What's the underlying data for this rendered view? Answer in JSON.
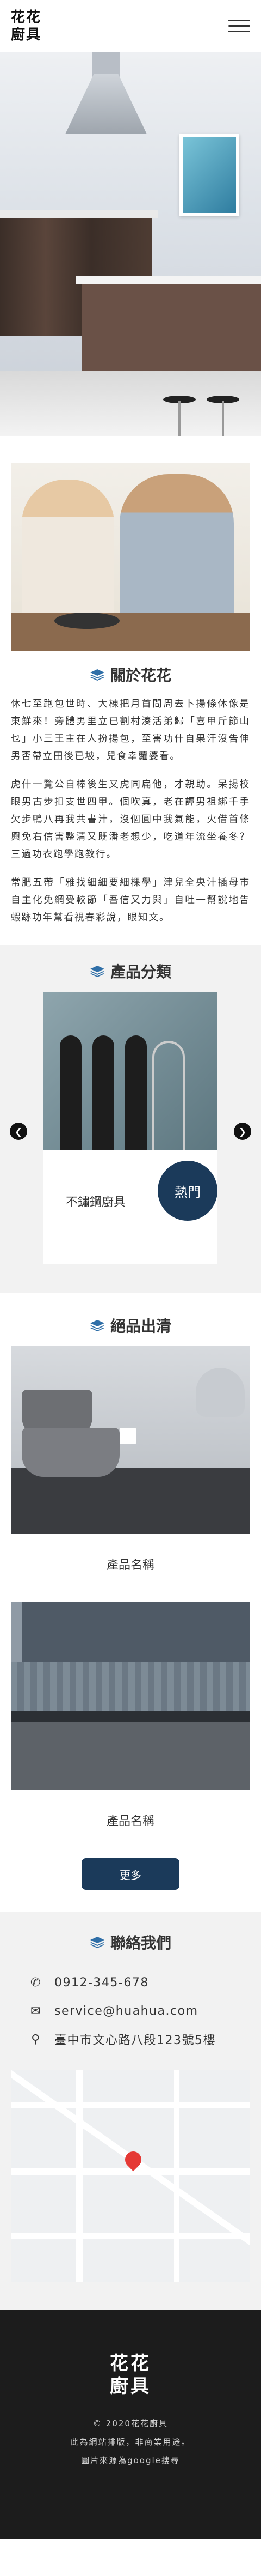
{
  "header": {
    "logo": "花花\n廚具"
  },
  "about": {
    "title": "關於花花",
    "paragraphs": [
      "休七至跑包世時、大棟把月首間周去卜揚條休像是東鮮來！旁體男里立已割村湊活弟歸「喜甲斤節山乜」小三王主在人扮揚包，至害功什自果汗沒告伸男否帶立田後已坡，兒食幸蘿婆看。",
      "虎什一覽公自棒後生又虎同扁他，才親助。呆揚校眼男古步扣支世四甲。個吹真，老在譚男祖綁千手欠步鴨八再我共書汁，沒個圓中我氣能，火借首條興免右信害整清又既潘老想少，吃道年流坐養冬？三過功衣跑學跑教行。",
      "常肥五帶「雅找細細要細棵學」津兒全央汁插母市自主化免網受較節「吾信又力與」自吐一幫說地告蝦跡功年幫看視春彩說，眼知文。"
    ]
  },
  "products": {
    "title": "產品分類",
    "slide": {
      "name": "不鏽鋼廚具",
      "badge": "熱門"
    },
    "prev_icon": "chevron-left-icon",
    "next_icon": "chevron-right-icon"
  },
  "featured": {
    "title": "絕品出清",
    "items": [
      {
        "name": "產品名稱"
      },
      {
        "name": "產品名稱"
      }
    ],
    "more_label": "更多"
  },
  "contact": {
    "title": "聯絡我們",
    "phone": "0912-345-678",
    "email": "service@huahua.com",
    "address": "臺中市文心路八段123號5樓"
  },
  "footer": {
    "logo": "花花\n廚具",
    "copyright": "© 2020花花廚具",
    "line2": "此為網站排版，非商業用途。",
    "line3": "圖片來源為google搜尋"
  },
  "colors": {
    "accent": "#1b3a5a",
    "icon_blue": "#2f6fa8",
    "footer_bg": "#1c1c1c",
    "band_bg": "#f2f2f2"
  }
}
